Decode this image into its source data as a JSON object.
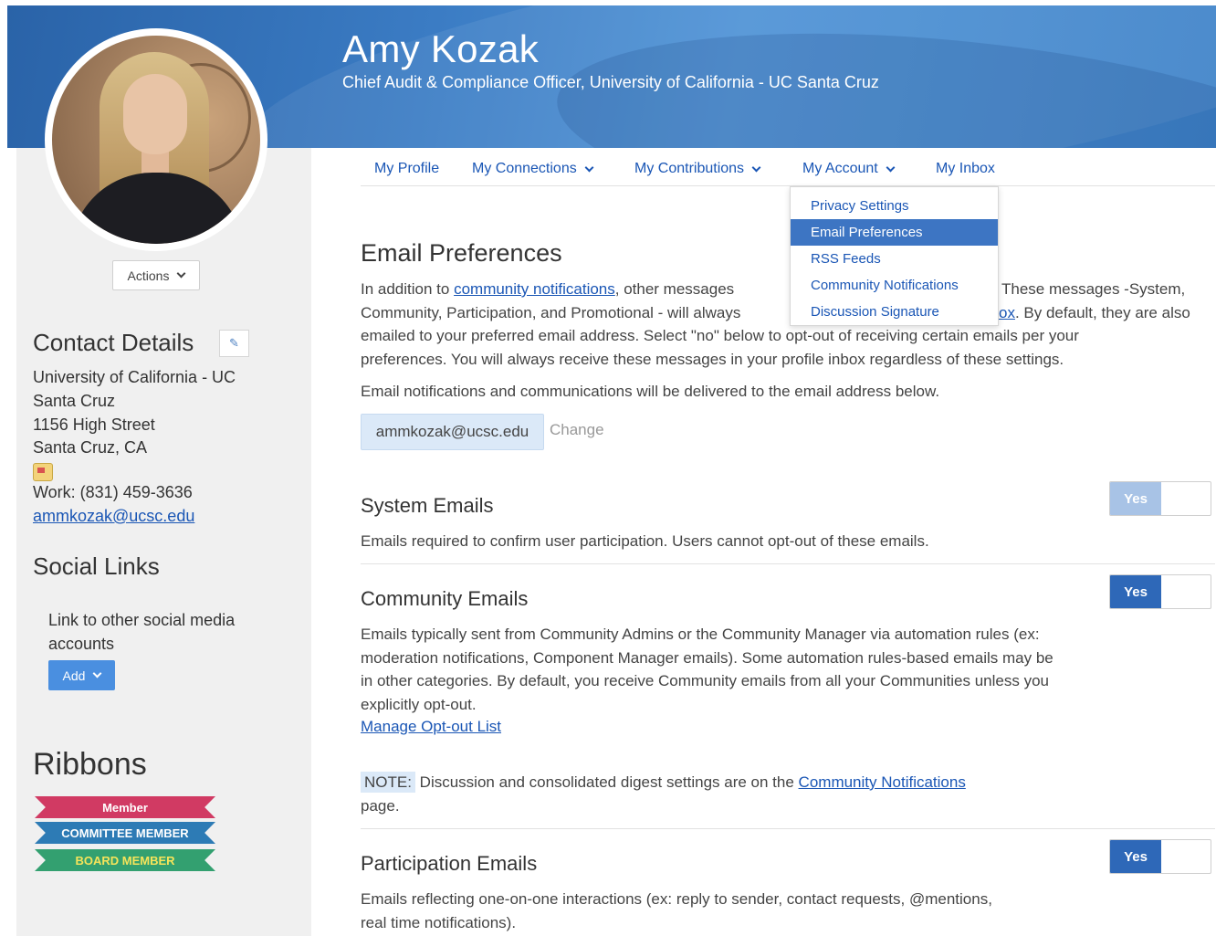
{
  "profile": {
    "name": "Amy Kozak",
    "title": "Chief Audit & Compliance Officer, University of California - UC Santa Cruz"
  },
  "sidebar": {
    "actions_label": "Actions",
    "contact_heading": "Contact Details",
    "contact_lines": [
      "University of California - UC",
      "Santa Cruz",
      "1156 High Street",
      "Santa Cruz, CA"
    ],
    "work_phone": "Work: (831) 459-3636",
    "email": "ammkozak@ucsc.edu",
    "social_heading": "Social Links",
    "social_text": "Link to other social media accounts",
    "add_label": "Add",
    "ribbons_heading": "Ribbons",
    "ribbons": [
      {
        "label": "Member",
        "color": "#d13a63"
      },
      {
        "label": "COMMITTEE MEMBER",
        "color": "#2d7bb5"
      },
      {
        "label": "BOARD MEMBER",
        "color": "#33a070"
      }
    ]
  },
  "nav": {
    "items": [
      {
        "label": "My Profile"
      },
      {
        "label": "My Connections"
      },
      {
        "label": "My Contributions"
      },
      {
        "label": "My Account"
      },
      {
        "label": "My Inbox"
      }
    ]
  },
  "account_menu": {
    "items": [
      "Privacy Settings",
      "Email Preferences",
      "RSS Feeds",
      "Community Notifications",
      "Discussion Signature"
    ],
    "active": "Email Preferences"
  },
  "main": {
    "heading": "Email Preferences",
    "intro_prefix": "In addition to ",
    "intro_link": "community notifications",
    "intro_mid": ", other messages",
    "intro_after_menu": "These messages -System,",
    "intro_line2_start": "Community, Participation, and Promotional - will always",
    "intro_line2_link_end": "ox",
    "intro_line2_end": ". By default, they are also",
    "intro_line3": "emailed to your preferred email address. Select \"no\" below to opt-out of receiving certain emails per your",
    "intro_line4": "preferences. You will always receive these messages in your profile inbox regardless of these settings.",
    "delivery_note": "Email notifications and communications will be delivered to the email address below.",
    "email": "ammkozak@ucsc.edu",
    "change_label": "Change",
    "sections": [
      {
        "title": "System Emails",
        "desc": "Emails required to confirm user participation. Users cannot opt-out of these emails.",
        "toggle": "Yes",
        "disabled": true
      },
      {
        "title": "Community Emails",
        "desc": "Emails typically sent from Community Admins or the Community Manager via automation rules (ex: moderation notifications, Component Manager emails). Some automation rules-based emails may be in other categories. By default, you receive Community emails from all your Communities unless you explicitly opt-out.",
        "link": "Manage Opt-out List",
        "toggle": "Yes",
        "disabled": false
      },
      {
        "title": "Participation Emails",
        "desc": "Emails reflecting one-on-one interactions (ex: reply to sender, contact requests, @mentions, real time notifications).",
        "toggle": "Yes",
        "disabled": false
      }
    ],
    "note_label": "NOTE:",
    "note_text": " Discussion and consolidated digest settings are on the ",
    "note_link": "Community Notifications",
    "note_end": "page."
  }
}
